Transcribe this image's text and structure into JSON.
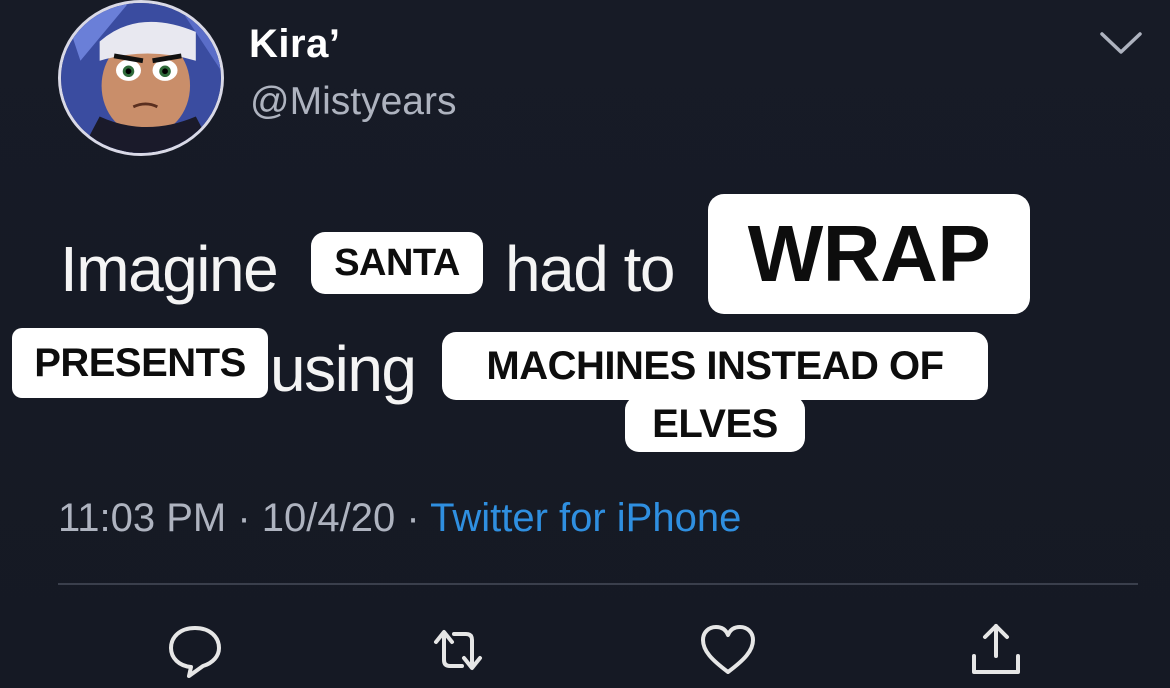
{
  "tweet": {
    "display_name": "Kira’",
    "handle": "@Mistyears",
    "text": {
      "word_imagine": "Imagine",
      "word_had_to": "had to",
      "word_using": "using"
    },
    "captions": {
      "santa": "SANTA",
      "wrap": "WRAP",
      "presents": "PRESENTS",
      "machines": "MACHINES INSTEAD OF",
      "elves": "ELVES"
    },
    "time": "11:03 PM",
    "separator": " · ",
    "date": "10/4/20",
    "source": "Twitter for iPhone"
  },
  "icons": {
    "menu": "chevron-down-icon",
    "reply": "reply-icon",
    "retweet": "retweet-icon",
    "like": "heart-icon",
    "share": "share-icon"
  },
  "colors": {
    "background": "#161a24",
    "link": "#2f8fe0",
    "secondary_text": "#aeb3bf",
    "caption_bg": "#ffffff"
  }
}
